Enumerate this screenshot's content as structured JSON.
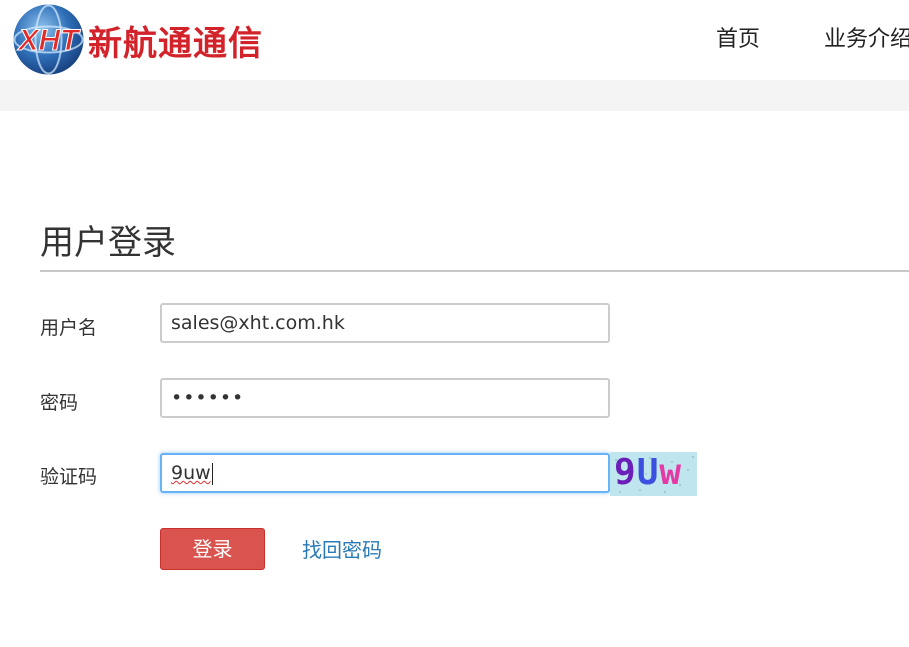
{
  "header": {
    "logo_text": "XHT",
    "brand": "新航通通信",
    "nav": [
      {
        "label": "首页"
      },
      {
        "label": "业务介绍"
      }
    ]
  },
  "login": {
    "title": "用户登录",
    "username": {
      "label": "用户名",
      "value": "sales@xht.com.hk"
    },
    "password": {
      "label": "密码",
      "value": "••••••"
    },
    "captcha": {
      "label": "验证码",
      "value": "9uw",
      "image_text": "9Uw"
    },
    "submit_label": "登录",
    "forgot_label": "找回密码"
  },
  "colors": {
    "brand_red": "#d3232a",
    "button_red": "#d9534f",
    "link_blue": "#2a7ab7",
    "focus_blue": "#68b3f5"
  }
}
